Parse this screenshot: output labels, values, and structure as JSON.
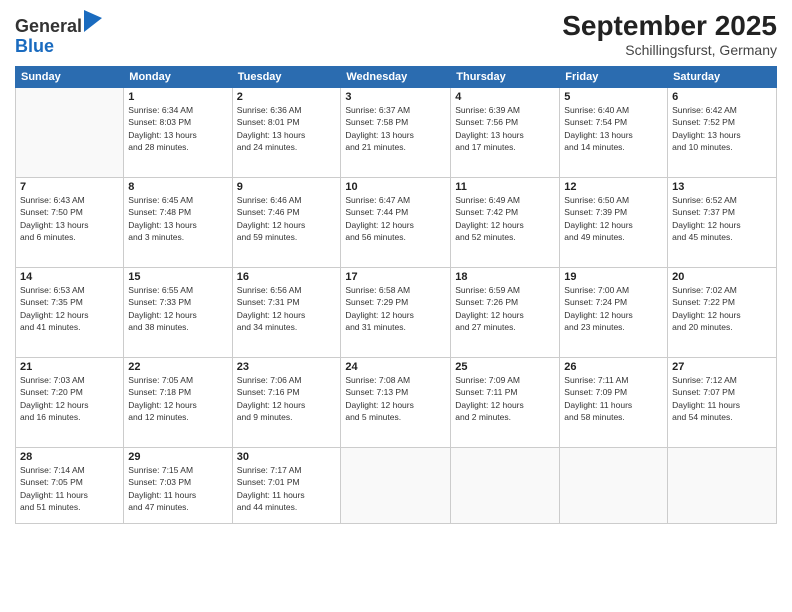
{
  "logo": {
    "general": "General",
    "blue": "Blue"
  },
  "header": {
    "month_year": "September 2025",
    "location": "Schillingsfurst, Germany"
  },
  "weekdays": [
    "Sunday",
    "Monday",
    "Tuesday",
    "Wednesday",
    "Thursday",
    "Friday",
    "Saturday"
  ],
  "weeks": [
    [
      {
        "day": "",
        "info": ""
      },
      {
        "day": "1",
        "info": "Sunrise: 6:34 AM\nSunset: 8:03 PM\nDaylight: 13 hours\nand 28 minutes."
      },
      {
        "day": "2",
        "info": "Sunrise: 6:36 AM\nSunset: 8:01 PM\nDaylight: 13 hours\nand 24 minutes."
      },
      {
        "day": "3",
        "info": "Sunrise: 6:37 AM\nSunset: 7:58 PM\nDaylight: 13 hours\nand 21 minutes."
      },
      {
        "day": "4",
        "info": "Sunrise: 6:39 AM\nSunset: 7:56 PM\nDaylight: 13 hours\nand 17 minutes."
      },
      {
        "day": "5",
        "info": "Sunrise: 6:40 AM\nSunset: 7:54 PM\nDaylight: 13 hours\nand 14 minutes."
      },
      {
        "day": "6",
        "info": "Sunrise: 6:42 AM\nSunset: 7:52 PM\nDaylight: 13 hours\nand 10 minutes."
      }
    ],
    [
      {
        "day": "7",
        "info": "Sunrise: 6:43 AM\nSunset: 7:50 PM\nDaylight: 13 hours\nand 6 minutes."
      },
      {
        "day": "8",
        "info": "Sunrise: 6:45 AM\nSunset: 7:48 PM\nDaylight: 13 hours\nand 3 minutes."
      },
      {
        "day": "9",
        "info": "Sunrise: 6:46 AM\nSunset: 7:46 PM\nDaylight: 12 hours\nand 59 minutes."
      },
      {
        "day": "10",
        "info": "Sunrise: 6:47 AM\nSunset: 7:44 PM\nDaylight: 12 hours\nand 56 minutes."
      },
      {
        "day": "11",
        "info": "Sunrise: 6:49 AM\nSunset: 7:42 PM\nDaylight: 12 hours\nand 52 minutes."
      },
      {
        "day": "12",
        "info": "Sunrise: 6:50 AM\nSunset: 7:39 PM\nDaylight: 12 hours\nand 49 minutes."
      },
      {
        "day": "13",
        "info": "Sunrise: 6:52 AM\nSunset: 7:37 PM\nDaylight: 12 hours\nand 45 minutes."
      }
    ],
    [
      {
        "day": "14",
        "info": "Sunrise: 6:53 AM\nSunset: 7:35 PM\nDaylight: 12 hours\nand 41 minutes."
      },
      {
        "day": "15",
        "info": "Sunrise: 6:55 AM\nSunset: 7:33 PM\nDaylight: 12 hours\nand 38 minutes."
      },
      {
        "day": "16",
        "info": "Sunrise: 6:56 AM\nSunset: 7:31 PM\nDaylight: 12 hours\nand 34 minutes."
      },
      {
        "day": "17",
        "info": "Sunrise: 6:58 AM\nSunset: 7:29 PM\nDaylight: 12 hours\nand 31 minutes."
      },
      {
        "day": "18",
        "info": "Sunrise: 6:59 AM\nSunset: 7:26 PM\nDaylight: 12 hours\nand 27 minutes."
      },
      {
        "day": "19",
        "info": "Sunrise: 7:00 AM\nSunset: 7:24 PM\nDaylight: 12 hours\nand 23 minutes."
      },
      {
        "day": "20",
        "info": "Sunrise: 7:02 AM\nSunset: 7:22 PM\nDaylight: 12 hours\nand 20 minutes."
      }
    ],
    [
      {
        "day": "21",
        "info": "Sunrise: 7:03 AM\nSunset: 7:20 PM\nDaylight: 12 hours\nand 16 minutes."
      },
      {
        "day": "22",
        "info": "Sunrise: 7:05 AM\nSunset: 7:18 PM\nDaylight: 12 hours\nand 12 minutes."
      },
      {
        "day": "23",
        "info": "Sunrise: 7:06 AM\nSunset: 7:16 PM\nDaylight: 12 hours\nand 9 minutes."
      },
      {
        "day": "24",
        "info": "Sunrise: 7:08 AM\nSunset: 7:13 PM\nDaylight: 12 hours\nand 5 minutes."
      },
      {
        "day": "25",
        "info": "Sunrise: 7:09 AM\nSunset: 7:11 PM\nDaylight: 12 hours\nand 2 minutes."
      },
      {
        "day": "26",
        "info": "Sunrise: 7:11 AM\nSunset: 7:09 PM\nDaylight: 11 hours\nand 58 minutes."
      },
      {
        "day": "27",
        "info": "Sunrise: 7:12 AM\nSunset: 7:07 PM\nDaylight: 11 hours\nand 54 minutes."
      }
    ],
    [
      {
        "day": "28",
        "info": "Sunrise: 7:14 AM\nSunset: 7:05 PM\nDaylight: 11 hours\nand 51 minutes."
      },
      {
        "day": "29",
        "info": "Sunrise: 7:15 AM\nSunset: 7:03 PM\nDaylight: 11 hours\nand 47 minutes."
      },
      {
        "day": "30",
        "info": "Sunrise: 7:17 AM\nSunset: 7:01 PM\nDaylight: 11 hours\nand 44 minutes."
      },
      {
        "day": "",
        "info": ""
      },
      {
        "day": "",
        "info": ""
      },
      {
        "day": "",
        "info": ""
      },
      {
        "day": "",
        "info": ""
      }
    ]
  ]
}
